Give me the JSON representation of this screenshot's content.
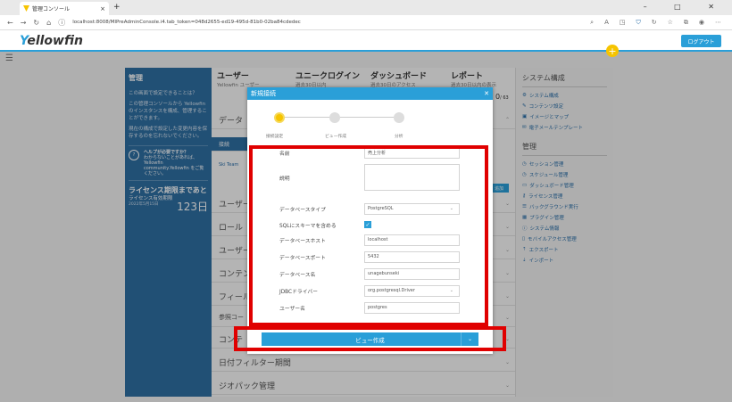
{
  "browser": {
    "tab_title": "管理コンソール",
    "url": "localhost:8008/MIPreAdminConsole.i4.tab_token=048d2655-ed19-495d-81b0-02ba84cdedec",
    "win_controls": "–  □  ✕"
  },
  "app": {
    "logo_a": "Y",
    "logo_b": "ellowfin",
    "logout": "ログアウト",
    "plus": "+"
  },
  "left": {
    "title": "管理",
    "q": "この画面で設定できることは？",
    "p1": "この管理コンソールから Yellowfin のインスタンスを構成、管理することができます。",
    "p2": "現在の構成で設定した変更内容を保存するのを忘れないでください。",
    "help_title": "ヘルプが必要ですか？",
    "help_text": "わからないことがあれば、Yellowfin community.Yellowfin をご覧ください。",
    "license_title": "ライセンス期限まであと",
    "license_sub": "ライセンス有効期限",
    "license_date": "2022年5月15日",
    "license_days": "123日"
  },
  "stats": [
    {
      "title": "ユーザー",
      "sub": "Yellowfin ユーザー"
    },
    {
      "title": "ユニークログイン",
      "sub": "過去30日以内"
    },
    {
      "title": "ダッシュボード",
      "sub": "過去30日のアクセス"
    },
    {
      "title": "レポート",
      "sub": "過去30日以内の表示"
    }
  ],
  "stat_count": "0",
  "stat_count_sub": "/ 63",
  "center_rows": [
    "データ",
    "接続",
    "ユーザー",
    "ロール",
    "ユーザー",
    "コンテン",
    "フィール",
    "参照コー",
    "コンテ",
    "日付フィルター期間",
    "ジオパック管理"
  ],
  "center_link": "Ski Team",
  "center_tag": "追加",
  "right": {
    "h1": "システム構成",
    "items1": [
      "システム構成",
      "コンテンツ設定",
      "イメージとマップ",
      "電子メールテンプレート"
    ],
    "h2": "管理",
    "items2": [
      "セッション管理",
      "スケジュール管理",
      "ダッシュボード管理",
      "ライセンス管理",
      "バックグラウンド実行",
      "プラグイン管理",
      "システム情報",
      "モバイルアクセス管理",
      "エクスポート",
      "インポート"
    ]
  },
  "modal": {
    "title": "新規接続",
    "close": "✕",
    "steps": [
      "接続設定",
      "ビュー作成",
      "分析"
    ],
    "fields": [
      {
        "label": "名前",
        "value": "売上分析"
      },
      {
        "label": "説明",
        "value": ""
      },
      {
        "label": "データベースタイプ",
        "value": "PostgreSQL"
      },
      {
        "label": "SQLにスキーマを含める",
        "value": "✓"
      },
      {
        "label": "データベースホスト",
        "value": "localhost"
      },
      {
        "label": "データベースポート",
        "value": "5432"
      },
      {
        "label": "データベース名",
        "value": "unagebunseki"
      },
      {
        "label": "JDBCドライバー",
        "value": "org.postgresql.Driver"
      },
      {
        "label": "ユーザー名",
        "value": "postgres"
      }
    ],
    "button": "ビュー作成",
    "dropdown": "⌄"
  },
  "colors": {
    "accent": "#2a9fd8",
    "highlight": "#e00000",
    "step_active": "#f6c400"
  }
}
